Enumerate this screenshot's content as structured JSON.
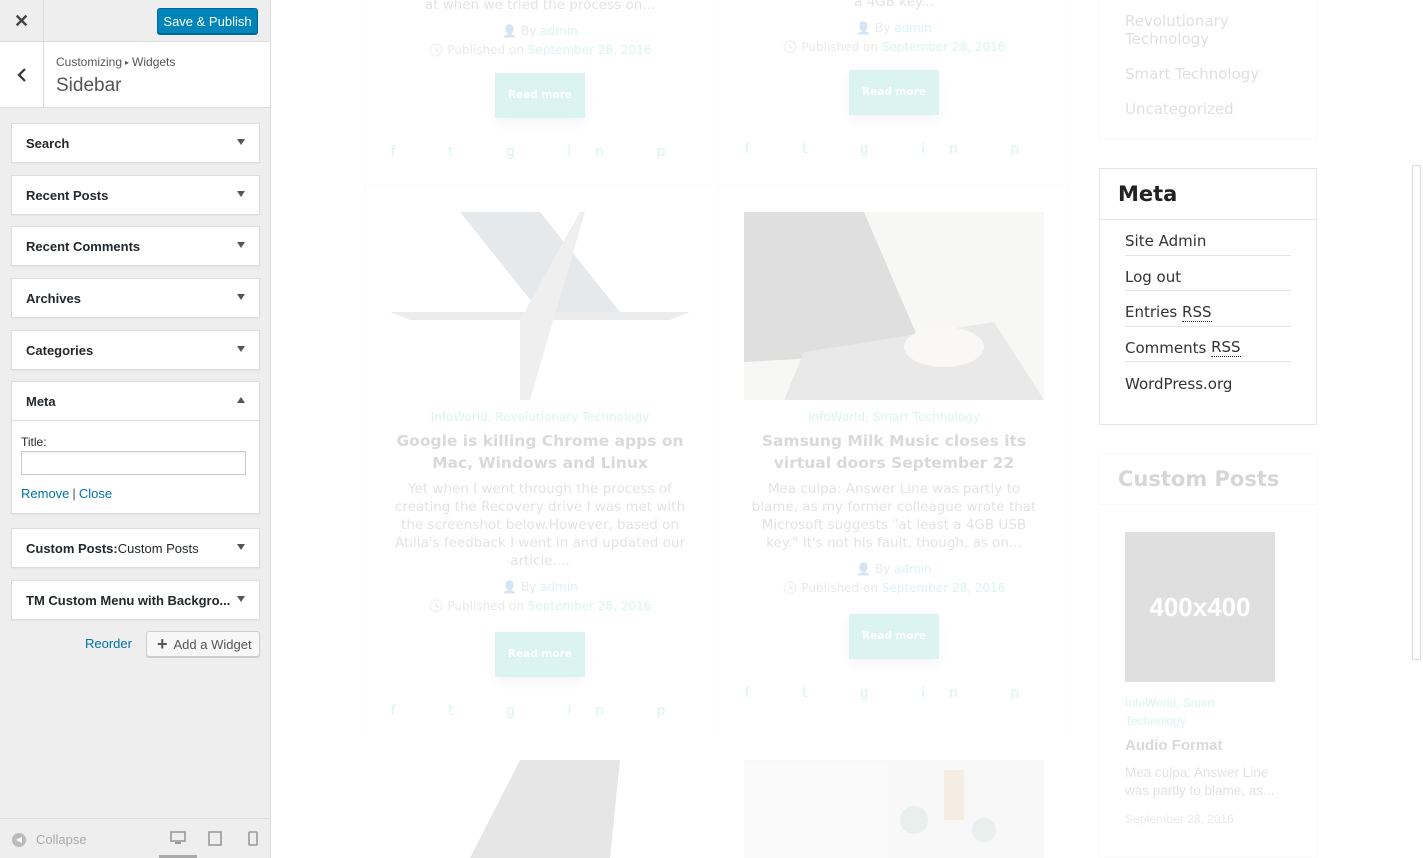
{
  "customizer": {
    "close_icon": "close-icon",
    "publish_label": "Save & Publish",
    "breadcrumb": [
      "Customizing",
      "Widgets"
    ],
    "section_title": "Sidebar",
    "widgets": [
      {
        "title": "Search",
        "suffix": ""
      },
      {
        "title": "Recent Posts",
        "suffix": ""
      },
      {
        "title": "Recent Comments",
        "suffix": ""
      },
      {
        "title": "Archives",
        "suffix": ""
      },
      {
        "title": "Categories",
        "suffix": ""
      },
      {
        "title": "Meta",
        "suffix": "",
        "expanded": true
      },
      {
        "title": "Custom Posts:",
        "suffix": " Custom Posts"
      },
      {
        "title": "TM Custom Menu with Backgro...",
        "suffix": ""
      }
    ],
    "meta_form": {
      "title_label": "Title:",
      "title_value": "",
      "remove_label": "Remove",
      "separator": "|",
      "close_label": "Close"
    },
    "reorder_label": "Reorder",
    "add_widget_label": "Add a Widget",
    "collapse_label": "Collapse"
  },
  "preview": {
    "top_posts": [
      {
        "excerpt_tail": "at when we tried the process on...",
        "author_prefix": "By",
        "author": "admin",
        "published_prefix": "Published on",
        "date": "September 28, 2016",
        "read_more": "Read more"
      },
      {
        "excerpt_tail": "a 4GB key...",
        "author_prefix": "By",
        "author": "admin",
        "published_prefix": "Published on",
        "date": "September 28, 2016",
        "read_more": "Read more"
      }
    ],
    "posts": [
      {
        "categories": "InfoWorld, Revolutionary Technology",
        "title": "Google is killing Chrome apps on Mac, Windows and Linux",
        "excerpt": "Yet when I went through the process of creating the Recovery drive I was met with the screenshot below.However, based on Atilla's feedback I went in and updated our article....",
        "author_prefix": "By",
        "author": "admin",
        "published_prefix": "Published on",
        "date": "September 28, 2016",
        "read_more": "Read more"
      },
      {
        "categories": "InfoWorld, Smart Technology",
        "title": "Samsung Milk Music closes its virtual doors September 22",
        "excerpt": "Mea culpa: Answer Line was partly to blame, as my former colleague wrote that Microsoft suggests \"at least a 4GB USB key.\" It's not his fault, though, as on...",
        "author_prefix": "By",
        "author": "admin",
        "published_prefix": "Published on",
        "date": "September 28, 2016",
        "read_more": "Read more"
      }
    ],
    "categories_list": [
      "Revolutionary Technology",
      "Smart Technology",
      "Uncategorized"
    ],
    "meta_widget": {
      "title": "Meta",
      "items": [
        "Site Admin",
        "Log out",
        "Entries",
        "Comments",
        "WordPress.org"
      ],
      "rss": "RSS"
    },
    "custom_posts": {
      "title": "Custom Posts",
      "placeholder": "400x400",
      "categories": "InfoWorld, Smart Technology",
      "post_title": "Audio Format",
      "excerpt": "Mea culpa: Answer Line was partly to blame, as...",
      "date": "September 28, 2016"
    }
  }
}
